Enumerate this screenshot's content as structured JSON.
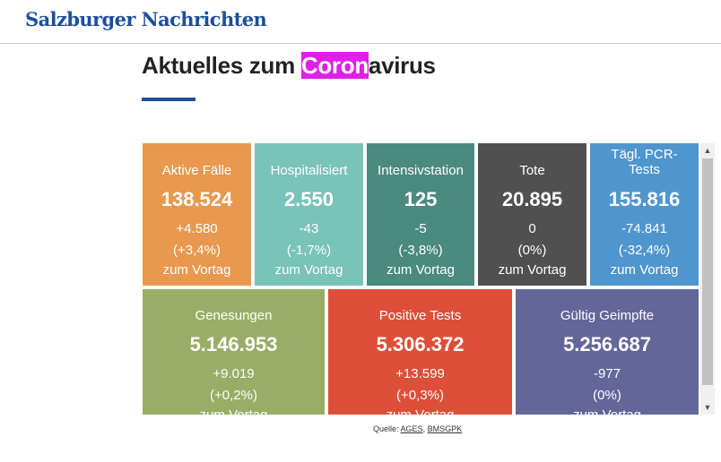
{
  "header": {
    "logo_text": "Salzburger Nachrichten"
  },
  "page": {
    "title_pre": "Aktuelles zum ",
    "title_highlight": "Coron",
    "title_post": "avirus"
  },
  "colors": {
    "brand": "#1d4f9a",
    "highlight": "#e020e8"
  },
  "tiles_row1": [
    {
      "label": "Aktive Fälle",
      "value": "138.524",
      "change": "+4.580",
      "percent": "(+3,4%)",
      "suffix": "zum Vortag",
      "color": "#e8994f"
    },
    {
      "label": "Hospitalisiert",
      "value": "2.550",
      "change": "-43",
      "percent": "(-1,7%)",
      "suffix": "zum Vortag",
      "color": "#79c3b8"
    },
    {
      "label": "Intensivstation",
      "value": "125",
      "change": "-5",
      "percent": "(-3,8%)",
      "suffix": "zum Vortag",
      "color": "#4a8a7f"
    },
    {
      "label": "Tote",
      "value": "20.895",
      "change": "0",
      "percent": "(0%)",
      "suffix": "zum Vortag",
      "color": "#505050"
    },
    {
      "label": "Tägl. PCR-Tests",
      "value": "155.816",
      "change": "-74.841",
      "percent": "(-32,4%)",
      "suffix": "zum Vortag",
      "color": "#4f96cf"
    }
  ],
  "tiles_row2": [
    {
      "label": "Genesungen",
      "value": "5.146.953",
      "change": "+9.019",
      "percent": "(+0,2%)",
      "suffix": "zum Vortag",
      "color": "#99ad66"
    },
    {
      "label": "Positive Tests",
      "value": "5.306.372",
      "change": "+13.599",
      "percent": "(+0,3%)",
      "suffix": "zum Vortag",
      "color": "#dd4f38"
    },
    {
      "label": "Gültig Geimpfte",
      "value": "5.256.687",
      "change": "-977",
      "percent": "(0%)",
      "suffix": "zum Vortag",
      "color": "#636699"
    }
  ],
  "source": {
    "label": "Quelle:",
    "link1": "AGES",
    "separator": ",",
    "link2": "BMSGPK"
  },
  "scrollbar": {
    "up_icon": "triangle-up",
    "down_icon": "triangle-down"
  }
}
